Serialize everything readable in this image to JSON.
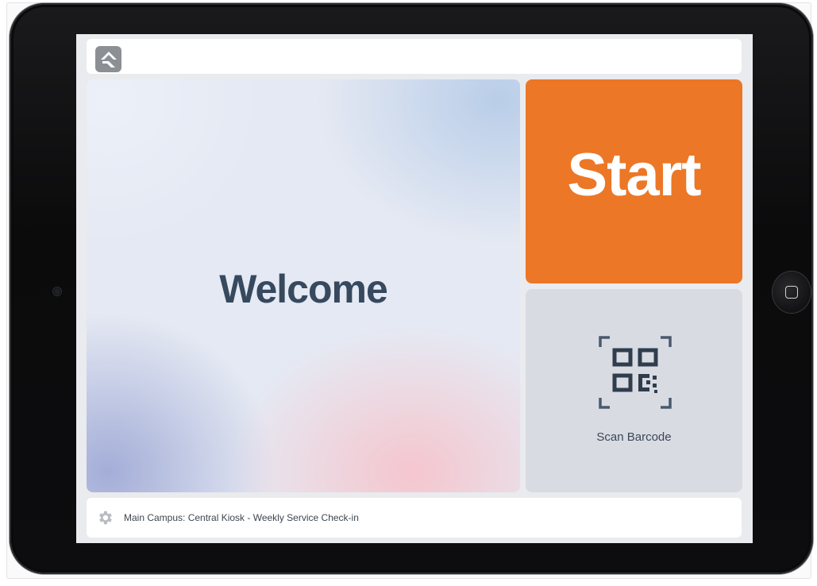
{
  "header": {
    "logo_icon": "rock-logo-icon"
  },
  "welcome": {
    "title": "Welcome"
  },
  "actions": {
    "start_label": "Start",
    "scan_label": "Scan Barcode",
    "scan_icon": "qr-code-icon"
  },
  "footer": {
    "settings_icon": "gear-icon",
    "status_text": "Main Campus: Central Kiosk - Weekly Service Check-in"
  },
  "colors": {
    "accent": "#ec7726",
    "text_dark": "#36495e",
    "scan_bg": "#d9dbe3"
  }
}
